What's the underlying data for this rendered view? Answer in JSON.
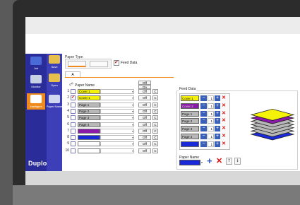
{
  "sidebar": {
    "items": [
      {
        "label": "Job",
        "icon": "job-icon"
      },
      {
        "label": "Save",
        "icon": "save-icon"
      },
      {
        "label": "Monitor",
        "icon": "monitor-icon"
      },
      {
        "label": "Open",
        "icon": "open-folder-icon"
      },
      {
        "label": "Intelligent",
        "icon": "intelligent-icon"
      },
      {
        "label": "Paper Name",
        "icon": "paper-name-icon"
      }
    ],
    "brand": "Duplo"
  },
  "paper_type": {
    "label": "Paper Type",
    "feed_data_checkbox": "Feed Data",
    "feed_data_checked": true
  },
  "tabs": [
    {
      "label": "A"
    }
  ],
  "paper_list": {
    "header": "Paper Name",
    "off_label": "Off",
    "on_label": "On",
    "c_label": "C",
    "rows": [
      {
        "num": "1",
        "checked": false,
        "name": "Cover 1",
        "color": "#f5f20a",
        "off": "Off"
      },
      {
        "num": "2",
        "checked": true,
        "name": "Cover 1",
        "color": "#f5f20a",
        "off": "Off"
      },
      {
        "num": "3",
        "checked": false,
        "name": "Page 1",
        "color": "#b8b8b8",
        "off": "Off"
      },
      {
        "num": "4",
        "checked": false,
        "name": "Page 2",
        "color": "#b8b8b8",
        "off": "Off"
      },
      {
        "num": "5",
        "checked": false,
        "name": "Page 3",
        "color": "#b8b8b8",
        "off": "Off"
      },
      {
        "num": "6",
        "checked": false,
        "name": "Page 4",
        "color": "#b8b8b8",
        "off": "Off"
      },
      {
        "num": "7",
        "checked": false,
        "name": "",
        "color": "#8a1aa8",
        "off": "Off"
      },
      {
        "num": "8",
        "checked": false,
        "name": "",
        "color": "#1a2ad8",
        "off": "Off"
      },
      {
        "num": "9",
        "checked": false,
        "name": "",
        "color": "#ffffff",
        "off": "Off"
      },
      {
        "num": "10",
        "checked": false,
        "name": "",
        "color": "#ffffff",
        "off": "Off"
      }
    ]
  },
  "feed_data": {
    "title": "Feed Data",
    "rows": [
      {
        "name": "Cover 1",
        "color": "#f5f20a",
        "value": "1"
      },
      {
        "name": "Cover 2",
        "color": "#8a1aa8",
        "value": "1"
      },
      {
        "name": "Page 1",
        "color": "#b8b8b8",
        "value": "1"
      },
      {
        "name": "Page 2",
        "color": "#b8b8b8",
        "value": "1"
      },
      {
        "name": "Page 3",
        "color": "#b8b8b8",
        "value": "1"
      },
      {
        "name": "Page 4",
        "color": "#b8b8b8",
        "value": "1"
      },
      {
        "name": "",
        "color": "#1a2ad8",
        "value": "1"
      }
    ],
    "paper_name_label": "Paper Name",
    "paper_name_color": "#1a2ad8"
  }
}
